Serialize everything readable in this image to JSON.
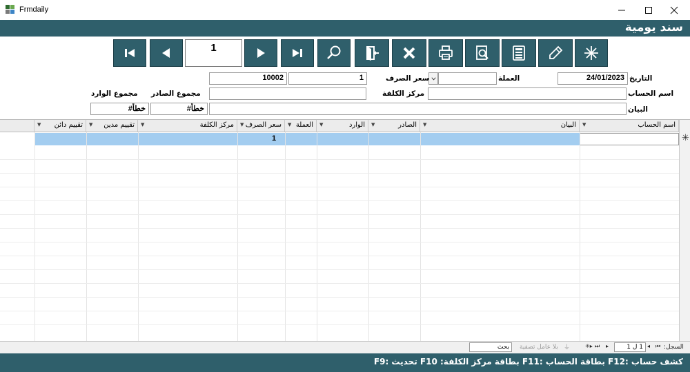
{
  "window": {
    "title": "Frmdaily"
  },
  "form": {
    "title": "سند يومية"
  },
  "toolbar": {
    "record_number": "1",
    "buttons": [
      {
        "name": "first-record-button",
        "icon": "skip-first-icon"
      },
      {
        "name": "previous-record-button",
        "icon": "play-left-icon"
      },
      {
        "name": "next-record-button",
        "icon": "play-right-icon"
      },
      {
        "name": "last-record-button",
        "icon": "skip-last-icon"
      },
      {
        "name": "search-button",
        "icon": "search-icon"
      },
      {
        "name": "exit-button",
        "icon": "exit-door-icon"
      },
      {
        "name": "delete-button",
        "icon": "x-icon"
      },
      {
        "name": "print-button",
        "icon": "printer-icon"
      },
      {
        "name": "preview-button",
        "icon": "preview-icon"
      },
      {
        "name": "calculator-button",
        "icon": "calculator-icon"
      },
      {
        "name": "edit-button",
        "icon": "pencil-icon"
      },
      {
        "name": "new-button",
        "icon": "asterisk-icon"
      }
    ]
  },
  "fields": {
    "date": {
      "label": "التاريخ",
      "value": "24/01/2023"
    },
    "currency": {
      "label": "العملة",
      "value": ""
    },
    "exchange_rate": {
      "label": "سعر الصرف",
      "value": "1"
    },
    "document_number": {
      "value": "10002"
    },
    "account_name": {
      "label": "اسم الحساب",
      "value": ""
    },
    "cost_center": {
      "label": "مركز الكلفة",
      "value": ""
    },
    "description": {
      "label": "البيان",
      "value": ""
    },
    "total_outgoing": {
      "label": "مجموع الصادر",
      "value": "#خطأ"
    },
    "total_incoming": {
      "label": "مجموع الوارد",
      "value": "#خطأ"
    }
  },
  "grid": {
    "columns": [
      "اسم الحساب",
      "البيان",
      "الصادر",
      "الوارد",
      "العملة",
      "سعر الصرف",
      "مركز الكلفة",
      "تقييم مدين",
      "تقييم دائن"
    ],
    "rows": [
      {
        "exchange_rate": "1"
      }
    ]
  },
  "navigator": {
    "record_label": "السجل:",
    "position": "1 ل 1",
    "filter_label": "بلا عامل تصفية",
    "search_label": "بحث"
  },
  "status": {
    "shortcuts": "كشف حساب :F12  بطاقة الحساب :F11  بطاقة مركز الكلفة: F10  تحديث :F9"
  },
  "colors": {
    "accent": "#2f5f6b",
    "selection": "#a3cdf0"
  }
}
